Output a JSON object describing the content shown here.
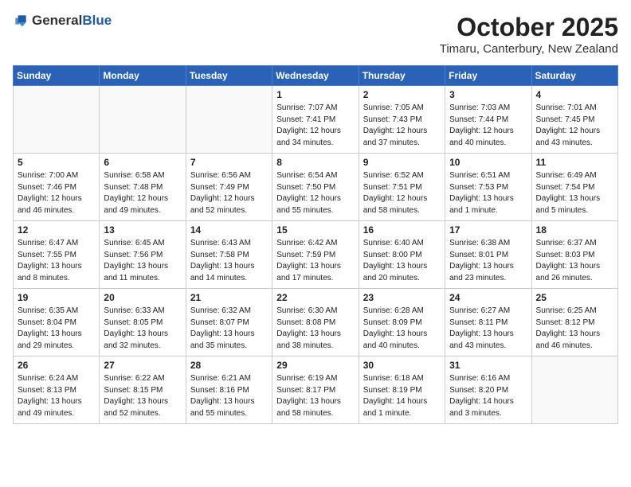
{
  "header": {
    "logo_general": "General",
    "logo_blue": "Blue",
    "month": "October 2025",
    "location": "Timaru, Canterbury, New Zealand"
  },
  "weekdays": [
    "Sunday",
    "Monday",
    "Tuesday",
    "Wednesday",
    "Thursday",
    "Friday",
    "Saturday"
  ],
  "weeks": [
    [
      {
        "day": "",
        "info": ""
      },
      {
        "day": "",
        "info": ""
      },
      {
        "day": "",
        "info": ""
      },
      {
        "day": "1",
        "info": "Sunrise: 7:07 AM\nSunset: 7:41 PM\nDaylight: 12 hours\nand 34 minutes."
      },
      {
        "day": "2",
        "info": "Sunrise: 7:05 AM\nSunset: 7:43 PM\nDaylight: 12 hours\nand 37 minutes."
      },
      {
        "day": "3",
        "info": "Sunrise: 7:03 AM\nSunset: 7:44 PM\nDaylight: 12 hours\nand 40 minutes."
      },
      {
        "day": "4",
        "info": "Sunrise: 7:01 AM\nSunset: 7:45 PM\nDaylight: 12 hours\nand 43 minutes."
      }
    ],
    [
      {
        "day": "5",
        "info": "Sunrise: 7:00 AM\nSunset: 7:46 PM\nDaylight: 12 hours\nand 46 minutes."
      },
      {
        "day": "6",
        "info": "Sunrise: 6:58 AM\nSunset: 7:48 PM\nDaylight: 12 hours\nand 49 minutes."
      },
      {
        "day": "7",
        "info": "Sunrise: 6:56 AM\nSunset: 7:49 PM\nDaylight: 12 hours\nand 52 minutes."
      },
      {
        "day": "8",
        "info": "Sunrise: 6:54 AM\nSunset: 7:50 PM\nDaylight: 12 hours\nand 55 minutes."
      },
      {
        "day": "9",
        "info": "Sunrise: 6:52 AM\nSunset: 7:51 PM\nDaylight: 12 hours\nand 58 minutes."
      },
      {
        "day": "10",
        "info": "Sunrise: 6:51 AM\nSunset: 7:53 PM\nDaylight: 13 hours\nand 1 minute."
      },
      {
        "day": "11",
        "info": "Sunrise: 6:49 AM\nSunset: 7:54 PM\nDaylight: 13 hours\nand 5 minutes."
      }
    ],
    [
      {
        "day": "12",
        "info": "Sunrise: 6:47 AM\nSunset: 7:55 PM\nDaylight: 13 hours\nand 8 minutes."
      },
      {
        "day": "13",
        "info": "Sunrise: 6:45 AM\nSunset: 7:56 PM\nDaylight: 13 hours\nand 11 minutes."
      },
      {
        "day": "14",
        "info": "Sunrise: 6:43 AM\nSunset: 7:58 PM\nDaylight: 13 hours\nand 14 minutes."
      },
      {
        "day": "15",
        "info": "Sunrise: 6:42 AM\nSunset: 7:59 PM\nDaylight: 13 hours\nand 17 minutes."
      },
      {
        "day": "16",
        "info": "Sunrise: 6:40 AM\nSunset: 8:00 PM\nDaylight: 13 hours\nand 20 minutes."
      },
      {
        "day": "17",
        "info": "Sunrise: 6:38 AM\nSunset: 8:01 PM\nDaylight: 13 hours\nand 23 minutes."
      },
      {
        "day": "18",
        "info": "Sunrise: 6:37 AM\nSunset: 8:03 PM\nDaylight: 13 hours\nand 26 minutes."
      }
    ],
    [
      {
        "day": "19",
        "info": "Sunrise: 6:35 AM\nSunset: 8:04 PM\nDaylight: 13 hours\nand 29 minutes."
      },
      {
        "day": "20",
        "info": "Sunrise: 6:33 AM\nSunset: 8:05 PM\nDaylight: 13 hours\nand 32 minutes."
      },
      {
        "day": "21",
        "info": "Sunrise: 6:32 AM\nSunset: 8:07 PM\nDaylight: 13 hours\nand 35 minutes."
      },
      {
        "day": "22",
        "info": "Sunrise: 6:30 AM\nSunset: 8:08 PM\nDaylight: 13 hours\nand 38 minutes."
      },
      {
        "day": "23",
        "info": "Sunrise: 6:28 AM\nSunset: 8:09 PM\nDaylight: 13 hours\nand 40 minutes."
      },
      {
        "day": "24",
        "info": "Sunrise: 6:27 AM\nSunset: 8:11 PM\nDaylight: 13 hours\nand 43 minutes."
      },
      {
        "day": "25",
        "info": "Sunrise: 6:25 AM\nSunset: 8:12 PM\nDaylight: 13 hours\nand 46 minutes."
      }
    ],
    [
      {
        "day": "26",
        "info": "Sunrise: 6:24 AM\nSunset: 8:13 PM\nDaylight: 13 hours\nand 49 minutes."
      },
      {
        "day": "27",
        "info": "Sunrise: 6:22 AM\nSunset: 8:15 PM\nDaylight: 13 hours\nand 52 minutes."
      },
      {
        "day": "28",
        "info": "Sunrise: 6:21 AM\nSunset: 8:16 PM\nDaylight: 13 hours\nand 55 minutes."
      },
      {
        "day": "29",
        "info": "Sunrise: 6:19 AM\nSunset: 8:17 PM\nDaylight: 13 hours\nand 58 minutes."
      },
      {
        "day": "30",
        "info": "Sunrise: 6:18 AM\nSunset: 8:19 PM\nDaylight: 14 hours\nand 1 minute."
      },
      {
        "day": "31",
        "info": "Sunrise: 6:16 AM\nSunset: 8:20 PM\nDaylight: 14 hours\nand 3 minutes."
      },
      {
        "day": "",
        "info": ""
      }
    ]
  ]
}
